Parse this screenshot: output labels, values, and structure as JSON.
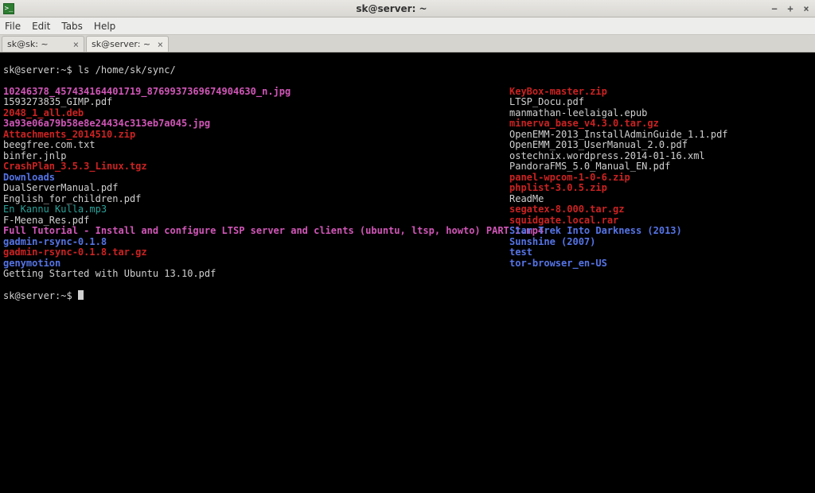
{
  "window": {
    "title": "sk@server: ~",
    "app_icon_glyph": ">_"
  },
  "menu": {
    "file": "File",
    "edit": "Edit",
    "tabs": "Tabs",
    "help": "Help"
  },
  "tabs": [
    {
      "label": "sk@sk: ~",
      "active": false
    },
    {
      "label": "sk@server: ~",
      "active": true
    }
  ],
  "prompt": {
    "line1_prefix": "sk@server:~$ ",
    "command": "ls /home/sk/sync/",
    "line_last": "sk@server:~$ "
  },
  "columns": {
    "left": [
      {
        "text": "10246378_457434164401719_8769937369674904630_n.jpg",
        "cls": "c-magenta"
      },
      {
        "text": "1593273835_GIMP.pdf",
        "cls": "c-default"
      },
      {
        "text": "2048_1_all.deb",
        "cls": "c-red"
      },
      {
        "text": "3a93e06a79b58e8e24434c313eb7a045.jpg",
        "cls": "c-magenta"
      },
      {
        "text": "Attachments_2014510.zip",
        "cls": "c-red"
      },
      {
        "text": "beegfree.com.txt",
        "cls": "c-default"
      },
      {
        "text": "binfer.jnlp",
        "cls": "c-default"
      },
      {
        "text": "CrashPlan_3.5.3_Linux.tgz",
        "cls": "c-red"
      },
      {
        "text": "Downloads",
        "cls": "c-blue"
      },
      {
        "text": "DualServerManual.pdf",
        "cls": "c-default"
      },
      {
        "text": "English_for_children.pdf",
        "cls": "c-default"
      },
      {
        "text": "En Kannu Kulla.mp3",
        "cls": "c-cyan"
      },
      {
        "text": "F-Meena_Res.pdf",
        "cls": "c-default"
      },
      {
        "text": "Full Tutorial - Install and configure LTSP server and clients (ubuntu, ltsp, howto) PART 1.mp4",
        "cls": "c-magenta"
      },
      {
        "text": "gadmin-rsync-0.1.8",
        "cls": "c-blue"
      },
      {
        "text": "gadmin-rsync-0.1.8.tar.gz",
        "cls": "c-red"
      },
      {
        "text": "genymotion",
        "cls": "c-blue"
      },
      {
        "text": "Getting Started with Ubuntu 13.10.pdf",
        "cls": "c-default"
      }
    ],
    "right": [
      {
        "text": "KeyBox-master.zip",
        "cls": "c-red"
      },
      {
        "text": "LTSP_Docu.pdf",
        "cls": "c-default"
      },
      {
        "text": "manmathan-leelaigal.epub",
        "cls": "c-default"
      },
      {
        "text": "minerva_base_v4.3.0.tar.gz",
        "cls": "c-red"
      },
      {
        "text": "OpenEMM-2013_InstallAdminGuide_1.1.pdf",
        "cls": "c-default"
      },
      {
        "text": "OpenEMM_2013_UserManual_2.0.pdf",
        "cls": "c-default"
      },
      {
        "text": "ostechnix.wordpress.2014-01-16.xml",
        "cls": "c-default"
      },
      {
        "text": "PandoraFMS_5.0_Manual_EN.pdf",
        "cls": "c-default"
      },
      {
        "text": "panel-wpcom-1-0-6.zip",
        "cls": "c-red"
      },
      {
        "text": "phplist-3.0.5.zip",
        "cls": "c-red"
      },
      {
        "text": "ReadMe",
        "cls": "c-default"
      },
      {
        "text": "segatex-8.000.tar.gz",
        "cls": "c-red"
      },
      {
        "text": "squidgate.local.rar",
        "cls": "c-red"
      },
      {
        "text": "Star Trek Into Darkness (2013)",
        "cls": "c-blue"
      },
      {
        "text": "Sunshine (2007)",
        "cls": "c-blue"
      },
      {
        "text": "test",
        "cls": "c-blue"
      },
      {
        "text": "tor-browser_en-US",
        "cls": "c-blue"
      }
    ]
  }
}
